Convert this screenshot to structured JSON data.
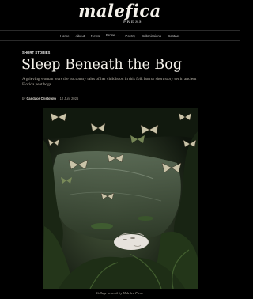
{
  "site": {
    "logo_text": "malefica",
    "logo_sub": "PRESS"
  },
  "nav": {
    "items": [
      "Home",
      "About",
      "News",
      "Prose ⌄",
      "Poetry",
      "Submissions",
      "Contact"
    ]
  },
  "article": {
    "category": "SHORT STORIES",
    "title": "Sleep Beneath the Bog",
    "deck": "A grieving woman tears the noctonary tales of her childhood in this folk horror short story set in ancient Florida peat bogs.",
    "byline_prefix": "by",
    "author": "Candace Cristofolo",
    "date": "10 Jun, 2026",
    "image_caption": "Collage artwork by Malefica Press."
  }
}
